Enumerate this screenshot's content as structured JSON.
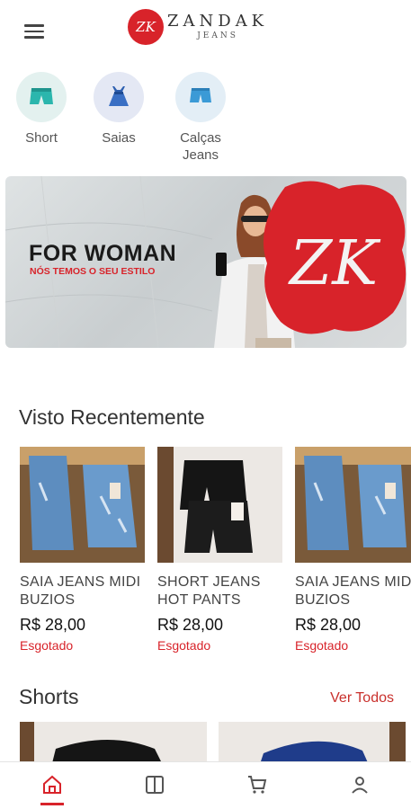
{
  "header": {
    "menu_icon": "hamburger-menu-icon",
    "logo_mark": "ZK",
    "logo_name": "ZANDAK",
    "logo_sub": "JEANS"
  },
  "categories": [
    {
      "label": "Short",
      "icon": "shorts-icon",
      "bg": "#e3f1ef"
    },
    {
      "label": "Saias",
      "icon": "skirt-icon",
      "bg": "#e4e8f4"
    },
    {
      "label": "Calças\nJeans",
      "icon": "jeans-icon",
      "bg": "#e3eef6"
    }
  ],
  "banner": {
    "title": "FOR WOMAN",
    "subtitle": "NÓS TEMOS O SEU ESTILO",
    "mark": "ZK",
    "accent": "#d8232a"
  },
  "recent": {
    "title": "Visto Recentemente",
    "products": [
      {
        "name": "SAIA JEANS MIDI BUZIOS",
        "price": "R$ 28,00",
        "status": "Esgotado"
      },
      {
        "name": "SHORT JEANS HOT PANTS",
        "price": "R$ 28,00",
        "status": "Esgotado"
      },
      {
        "name": "SAIA JEANS MIDI BUZIOS",
        "price": "R$ 28,00",
        "status": "Esgotado"
      }
    ]
  },
  "shorts": {
    "title": "Shorts",
    "see_all": "Ver Todos"
  },
  "bottom_nav": [
    {
      "icon": "home-icon",
      "active": true
    },
    {
      "icon": "catalog-icon",
      "active": false
    },
    {
      "icon": "cart-icon",
      "active": false
    },
    {
      "icon": "profile-icon",
      "active": false
    }
  ],
  "colors": {
    "accent": "#d8232a",
    "text": "#333333"
  }
}
